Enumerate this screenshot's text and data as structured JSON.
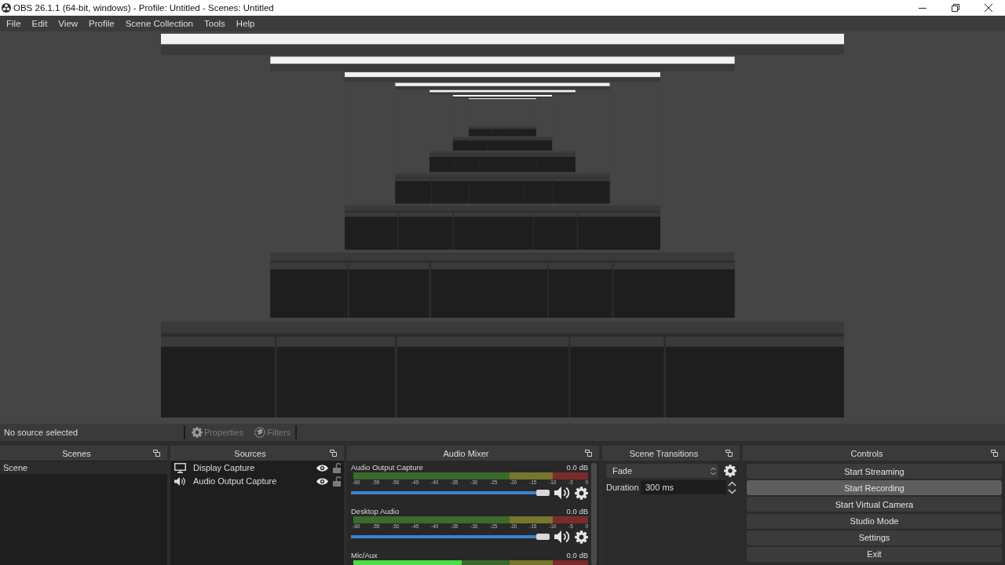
{
  "window": {
    "title": "OBS 26.1.1 (64-bit, windows) - Profile: Untitled - Scenes: Untitled"
  },
  "menu": [
    "File",
    "Edit",
    "View",
    "Profile",
    "Scene Collection",
    "Tools",
    "Help"
  ],
  "source_toolbar": {
    "status": "No source selected",
    "buttons": [
      {
        "kind": "properties",
        "label": "Properties",
        "disabled": true
      },
      {
        "kind": "filters",
        "label": "Filters",
        "disabled": true
      }
    ]
  },
  "scenes": {
    "title": "Scenes",
    "items": [
      {
        "name": "Scene",
        "selected": true
      }
    ]
  },
  "sources": {
    "title": "Sources",
    "items": [
      {
        "kind": "display",
        "name": "Display Capture",
        "visible": true,
        "locked": false
      },
      {
        "kind": "audio",
        "name": "Audio Output Capture",
        "visible": true,
        "locked": false
      }
    ]
  },
  "audio_mixer": {
    "title": "Audio Mixer",
    "channels": [
      {
        "name": "Audio Output Capture",
        "reading": "0.0 dB",
        "scale": [
          "-60",
          "-55",
          "-50",
          "-45",
          "-40",
          "-35",
          "-30",
          "-25",
          "-20",
          "-15",
          "-10",
          "-5",
          "0"
        ],
        "volume": {
          "level": 1
        },
        "muted": false
      },
      {
        "name": "Desktop Audio",
        "reading": "0.0 dB",
        "scale": [
          "-60",
          "-55",
          "-50",
          "-45",
          "-40",
          "-35",
          "-30",
          "-25",
          "-20",
          "-15",
          "-10",
          "-5",
          "0"
        ],
        "volume": {
          "level": 1
        },
        "muted": false
      },
      {
        "name": "Mic/Aux",
        "reading": "0.0 dB",
        "meter": {
          "level": 0.46
        }
      }
    ]
  },
  "scene_transitions": {
    "title": "Scene Transitions",
    "transition": "Fade",
    "duration_label": "Duration",
    "duration": "300 ms"
  },
  "controls": {
    "title": "Controls",
    "buttons": [
      {
        "label": "Start Streaming",
        "hovered": false
      },
      {
        "label": "Start Recording",
        "hovered": true
      },
      {
        "label": "Start Virtual Camera",
        "hovered": false
      },
      {
        "label": "Studio Mode",
        "hovered": false
      },
      {
        "label": "Settings",
        "hovered": false
      },
      {
        "label": "Exit",
        "hovered": false
      }
    ]
  }
}
